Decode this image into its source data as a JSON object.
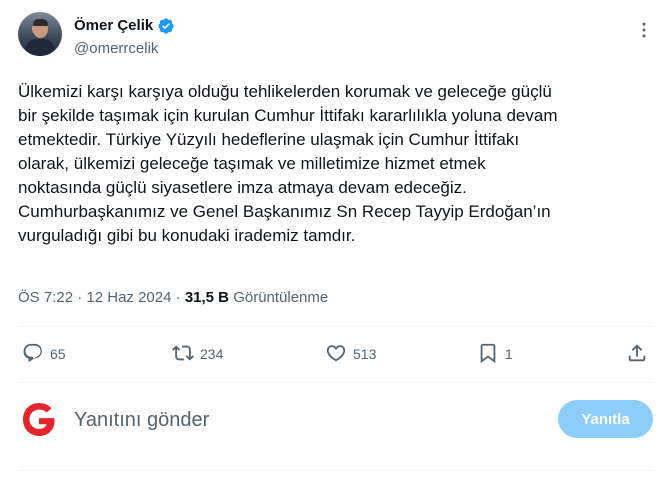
{
  "author": {
    "display_name": "Ömer Çelik",
    "handle": "@omerrcelik",
    "verified": true
  },
  "tweet": {
    "text": "Ülkemizi karşı karşıya olduğu tehlikelerden korumak ve geleceğe güçlü\nbir şekilde taşımak için kurulan Cumhur İttifakı kararlılıkla yoluna devam\netmektedir. Türkiye Yüzyılı hedeflerine ulaşmak için Cumhur İttifakı\nolarak, ülkemizi geleceğe taşımak ve milletimize hizmet etmek\nnoktasında güçlü siyasetlere imza atmaya devam edeceğiz.\nCumhurbaşkanımız ve Genel Başkanımız Sn Recep Tayyip Erdoğan’ın\nvurguladığı gibi bu konudaki irademiz tamdır.",
    "time": "ÖS 7:22",
    "separator": " · ",
    "date": "12 Haz 2024",
    "views_count": "31,5 B",
    "views_label": "Görüntülenme"
  },
  "actions": {
    "replies": "65",
    "retweets": "234",
    "likes": "513",
    "bookmarks": "1"
  },
  "reply_box": {
    "placeholder": "Yanıtını gönder",
    "button_label": "Yanıtla"
  },
  "colors": {
    "text_primary": "#0f1419",
    "text_secondary": "#536471",
    "verified_blue": "#1d9bf0",
    "reply_button_disabled": "#8ecdf8",
    "reply_avatar_red": "#e3262c"
  },
  "icons": [
    "verified-badge-icon",
    "more-icon",
    "reply-icon",
    "retweet-icon",
    "like-icon",
    "bookmark-icon",
    "share-icon"
  ]
}
